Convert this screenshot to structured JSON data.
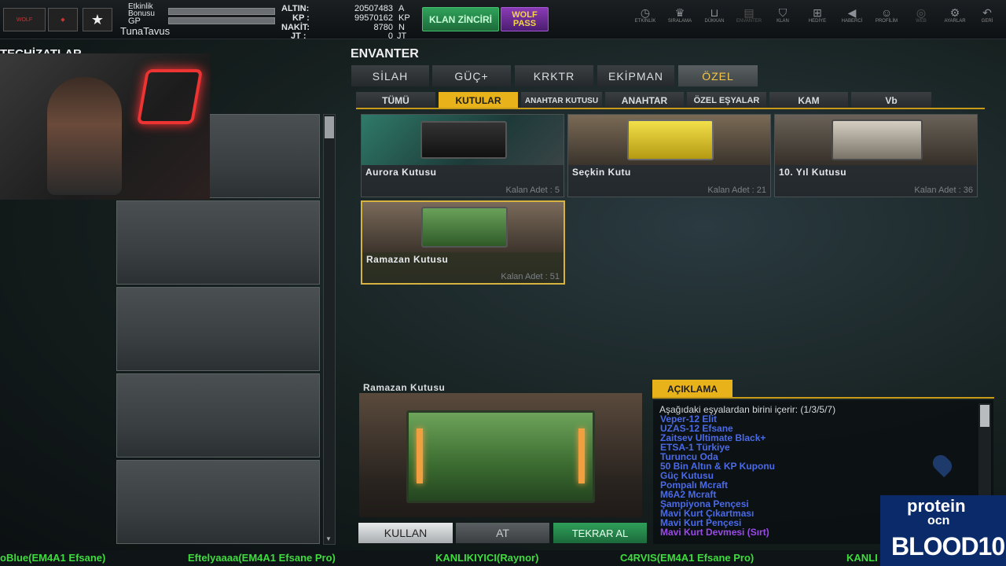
{
  "topbar": {
    "event_bonus_label": "Etkinlik Bonusu",
    "gp_label": "GP",
    "username": "TunaTavus",
    "stats": [
      {
        "label": "ALTIN:",
        "value": "20507483",
        "unit": "A"
      },
      {
        "label": "KP :",
        "value": "99570162",
        "unit": "KP"
      },
      {
        "label": "NAKİT:",
        "value": "8780",
        "unit": "N"
      },
      {
        "label": "JT :",
        "value": "0",
        "unit": "JT"
      }
    ],
    "clan_chain_label": "KLAN ZİNCİRİ",
    "wolf_pass_label": "WOLF PASS",
    "nav": [
      {
        "label": "ETKİNLİK",
        "icon": "clock-icon"
      },
      {
        "label": "SIRALAMA",
        "icon": "rank-icon"
      },
      {
        "label": "DÜKKAN",
        "icon": "cart-icon"
      },
      {
        "label": "ENVANTER",
        "icon": "inventory-icon"
      },
      {
        "label": "KLAN",
        "icon": "shield-icon"
      },
      {
        "label": "HEDİYE",
        "icon": "gift-icon"
      },
      {
        "label": "HABERCİ",
        "icon": "megaphone-icon"
      },
      {
        "label": "PROFİLİM",
        "icon": "profile-icon"
      },
      {
        "label": "WEB",
        "icon": "web-icon"
      },
      {
        "label": "AYARLAR",
        "icon": "gear-icon"
      },
      {
        "label": "GERİ",
        "icon": "back-icon"
      }
    ]
  },
  "left": {
    "title": "TEÇHİZATLAR"
  },
  "inventory": {
    "title": "ENVANTER",
    "tabs": [
      "SİLAH",
      "GÜÇ+",
      "KRKTR",
      "EKİPMAN",
      "ÖZEL"
    ],
    "active_tab": "ÖZEL",
    "subtabs": [
      "TÜMÜ",
      "KUTULAR",
      "ANAHTAR KUTUSU",
      "ANAHTAR",
      "ÖZEL EŞYALAR",
      "KAM",
      "Vb"
    ],
    "active_subtab": "KUTULAR",
    "cards": [
      {
        "name": "Aurora Kutusu",
        "count": "Kalan Adet : 5"
      },
      {
        "name": "Seçkin Kutu",
        "count": "Kalan Adet : 21"
      },
      {
        "name": "10. Yıl Kutusu",
        "count": "Kalan Adet : 36"
      },
      {
        "name": "Ramazan Kutusu",
        "count": "Kalan Adet : 51"
      }
    ]
  },
  "preview": {
    "name": "Ramazan Kutusu",
    "use_button": "KULLAN",
    "drop_button": "AT",
    "rebuy_button": "TEKRAR AL"
  },
  "description": {
    "tab": "AÇIKLAMA",
    "header": "Aşağıdaki eşyalardan birini içerir: (1/3/5/7)",
    "items": [
      "Veper-12 Elit",
      "UZAS-12 Efsane",
      "Zaitsev Ultimate Black+",
      "ETSA-1 Türkiye",
      "Turuncu Oda",
      "50 Bin Altın & KP Kuponu",
      "Güç Kutusu",
      "Pompalı Mcraft",
      "M6A2 Mcraft",
      "Şampiyona Pençesi",
      "Mavi Kurt Çıkartması",
      "Mavi Kurt Pençesi",
      "Mavi Kurt Devmesi (Sırt)"
    ]
  },
  "ticker": [
    "oBlue(EM4A1 Efsane)",
    "Eftelyaaaa(EM4A1 Efsane Pro)",
    "KANLIKIYICI(Raynor)",
    "C4RVIS(EM4A1 Efsane Pro)",
    "KANLI"
  ],
  "sponsor": {
    "line1": "protein",
    "line2": "ocn",
    "line3": "BLOOD10"
  }
}
